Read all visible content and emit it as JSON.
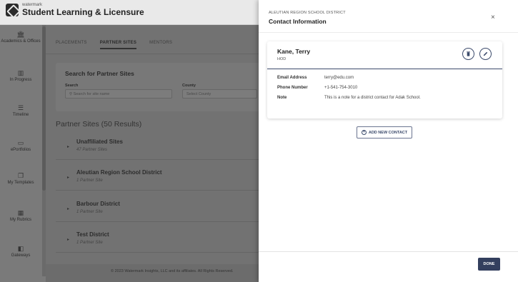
{
  "app": {
    "brand_small": "watermark",
    "brand_name": "Student Learning & Licensure"
  },
  "sidebar": {
    "items": [
      {
        "icon": "bank-icon",
        "glyph": "🏛",
        "label": "Academics & Offices"
      },
      {
        "icon": "chart-icon",
        "glyph": "▥",
        "label": "In Progress"
      },
      {
        "icon": "timeline-icon",
        "glyph": "☰",
        "label": "Timeline"
      },
      {
        "icon": "portfolio-icon",
        "glyph": "▭",
        "label": "ePortfolios"
      },
      {
        "icon": "template-icon",
        "glyph": "❐",
        "label": "My Templates"
      },
      {
        "icon": "rubric-icon",
        "glyph": "▦",
        "label": "My Rubrics"
      },
      {
        "icon": "gateway-icon",
        "glyph": "◧",
        "label": "Gateways"
      }
    ]
  },
  "tabs": [
    {
      "label": "PLACEMENTS"
    },
    {
      "label": "PARTNER SITES"
    },
    {
      "label": "MENTORS"
    }
  ],
  "search": {
    "title": "Search for Partner Sites",
    "search_label": "Search",
    "search_placeholder": "Search for site name",
    "county_label": "County",
    "county_placeholder": "Select County"
  },
  "results": {
    "title": "Partner Sites (50 Results)",
    "sites": [
      {
        "name": "Unaffiliated Sites",
        "sub": "47 Partner Sites"
      },
      {
        "name": "Aleutian Region School District",
        "sub": "1 Partner Site"
      },
      {
        "name": "Barbour District",
        "sub": "1 Partner Site"
      },
      {
        "name": "Test District",
        "sub": "1 Partner Site"
      }
    ]
  },
  "footer": {
    "text": "© 2023 Watermark Insights, LLC and its affiliates. All Rights Reserved."
  },
  "drawer": {
    "eyebrow": "ALEUTIAN REGION SCHOOL DISTRICT",
    "title": "Contact Information",
    "close": "×",
    "contact": {
      "name": "Kane, Terry",
      "role": "HOD",
      "email_label": "Email Address",
      "email": "terry@edu.com",
      "phone_label": "Phone Number",
      "phone": "+1-541-754-3010",
      "note_label": "Note",
      "note": "This is a note for a district contact for Adak School."
    },
    "add_contact_label": "ADD NEW CONTACT",
    "done_label": "DONE"
  }
}
